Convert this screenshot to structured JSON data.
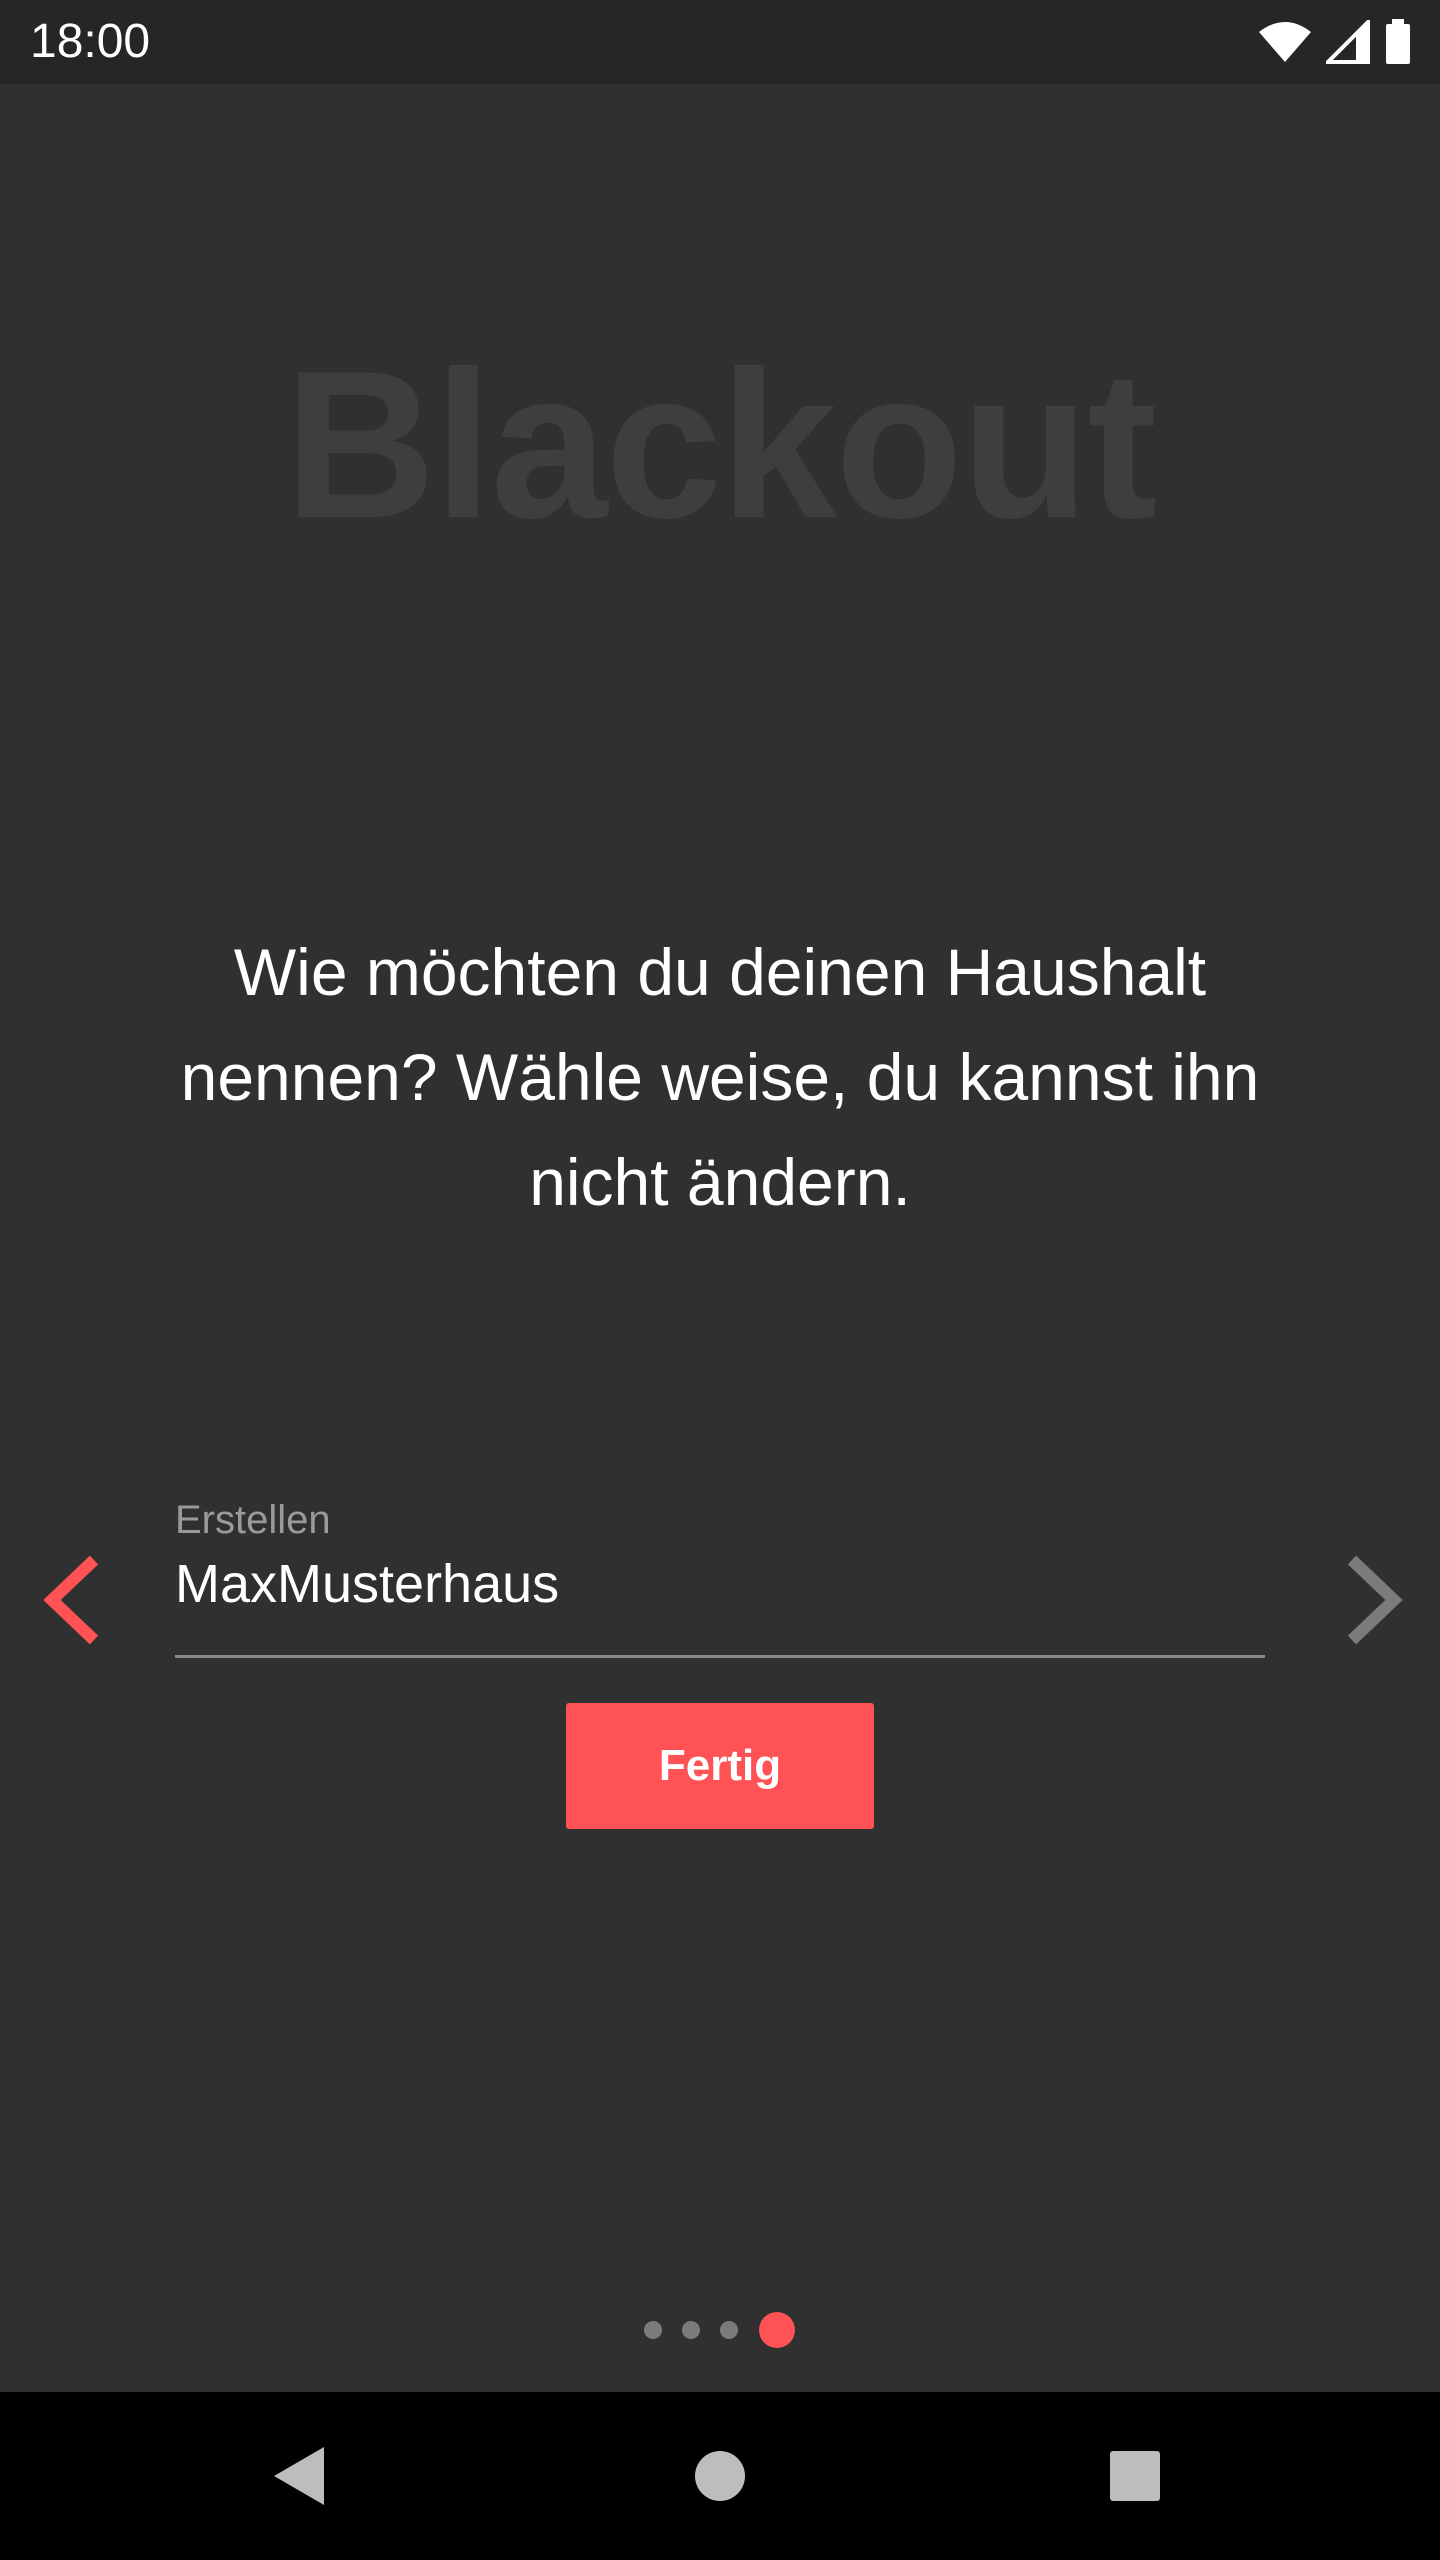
{
  "status_bar": {
    "time": "18:00",
    "icons": [
      "wifi-icon",
      "signal-icon",
      "battery-icon"
    ]
  },
  "app": {
    "title": "Blackout"
  },
  "onboarding": {
    "question": "Wie möchten du deinen Haushalt nennen? Wähle weise, du kannst ihn nicht ändern.",
    "input_label": "Erstellen",
    "input_value": "MaxMusterhaus",
    "done_button": "Fertig",
    "page_count": 4,
    "current_page": 4
  },
  "navigation": {
    "icons": [
      "back-icon",
      "home-icon",
      "recents-icon"
    ]
  },
  "colors": {
    "background": "#313031",
    "accent": "#fe5255",
    "watermark": "#3e3e3e",
    "status_bar": "#262626",
    "nav_bar": "#000000",
    "inactive_arrow": "#7b7b7b"
  }
}
